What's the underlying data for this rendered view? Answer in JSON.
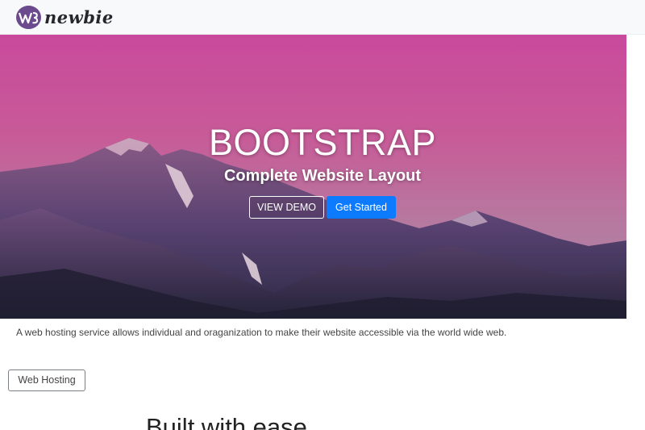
{
  "brand": {
    "badge_text": "W3",
    "name": "newbie",
    "badge_color": "#6b4b8e"
  },
  "hero": {
    "title": "BOOTSTRAP",
    "subtitle": "Complete Website Layout",
    "demo_button_label": "VIEW DEMO",
    "start_button_label": "Get Started",
    "start_button_color": "#0d7bff"
  },
  "intro": {
    "text": "A web hosting service allows individual and oraganization to make their website accessible via the world wide web."
  },
  "hosting_button_label": "Web Hosting",
  "section": {
    "heading": "Built with ease"
  }
}
